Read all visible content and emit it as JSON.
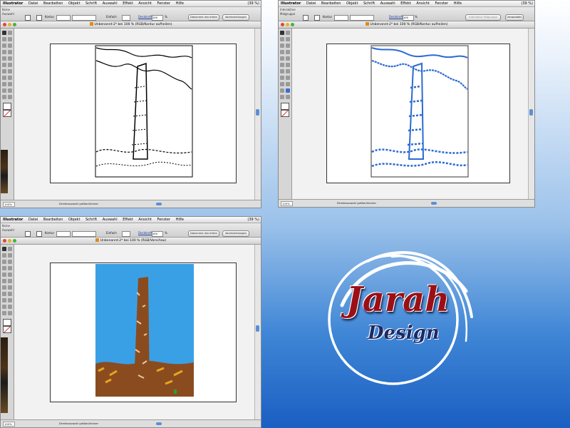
{
  "windows": [
    {
      "menu": {
        "app": "Illustrator",
        "items": [
          "Datei",
          "Bearbeiten",
          "Objekt",
          "Schrift",
          "Auswahl",
          "Effekt",
          "Ansicht",
          "Fenster",
          "Hilfe"
        ],
        "battery": "(39 %)"
      },
      "control": {
        "selection": "Keine Auswahl",
        "stroke_label": "Kontur",
        "basic_label": "Einfach",
        "opacity_label": "Deckkraft",
        "opacity_value": "100",
        "percent": "%",
        "doc_setup": "Dokument einrichten",
        "preferences": "Voreinstellungen"
      },
      "title": "Unbenannt-2* bei 100 % (RGB/Kontur aufheilen)",
      "status": {
        "zoom": "100%",
        "text": "Direktauswahl größer/kleiner"
      },
      "view": "outline"
    },
    {
      "menu": {
        "app": "Illustrator",
        "items": [
          "Datei",
          "Bearbeiten",
          "Objekt",
          "Schrift",
          "Auswahl",
          "Effekt",
          "Ansicht",
          "Fenster",
          "Hilfe"
        ],
        "battery": "(39 %)"
      },
      "control": {
        "selection": "Interaktive Malgruppe",
        "stroke_label": "Kontur",
        "basic_label": "",
        "opacity_label": "Deckkraft",
        "opacity_value": "100",
        "percent": "%",
        "doc_setup": "Interaktive Malgruppe umwandeln",
        "preferences": "Umwandeln"
      },
      "title": "Unbenannt-2* bei 100 % (RGB/Kontur aufheilen)",
      "status": {
        "zoom": "100%",
        "text": "Direktauswahl größer/kleiner"
      },
      "view": "selected"
    },
    {
      "menu": {
        "app": "Illustrator",
        "items": [
          "Datei",
          "Bearbeiten",
          "Objekt",
          "Schrift",
          "Auswahl",
          "Effekt",
          "Ansicht",
          "Fenster",
          "Hilfe"
        ],
        "battery": "(39 %)"
      },
      "control": {
        "selection": "Keine Auswahl",
        "stroke_label": "Kontur",
        "basic_label": "Einfach",
        "opacity_label": "Deckkraft",
        "opacity_value": "100",
        "percent": "%",
        "doc_setup": "Dokument einrichten",
        "preferences": "Voreinstellungen"
      },
      "title": "Unbenannt-2* bei 100 % (RGB/Vorschau)",
      "status": {
        "zoom": "100%",
        "text": "Direktauswahl größer/kleiner"
      },
      "view": "preview"
    }
  ],
  "logo": {
    "name": "Jarah",
    "sub": "Design"
  },
  "colors": {
    "accent": "#2b6ad4",
    "sky": "#3aa0e6",
    "brick": "#8a4c1f",
    "brand_red": "#9b0f15",
    "brand_navy": "#1d2a66"
  }
}
